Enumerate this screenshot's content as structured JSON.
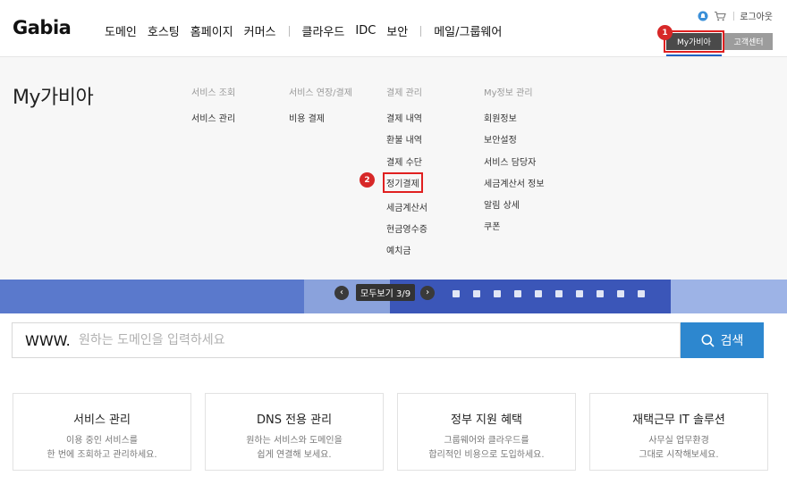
{
  "header": {
    "logo": "Gabia",
    "nav": [
      "도메인",
      "호스팅",
      "홈페이지",
      "커머스",
      "클라우드",
      "IDC",
      "보안",
      "메일/그룹웨어"
    ],
    "logout": "로그아웃",
    "tab_my": "My가비아",
    "tab_cs": "고객센터"
  },
  "annotations": {
    "badge1": "1",
    "badge2": "2"
  },
  "panel": {
    "title": "My가비아",
    "columns": [
      {
        "head": "서비스 조회",
        "links": [
          "서비스 관리"
        ]
      },
      {
        "head": "서비스 연장/결제",
        "links": [
          "비용 결제"
        ]
      },
      {
        "head": "결제 관리",
        "links": [
          "결제 내역",
          "환불 내역",
          "결제 수단",
          "정기결제",
          "세금계산서",
          "현금영수증",
          "예치금"
        ]
      },
      {
        "head": "My정보 관리",
        "links": [
          "회원정보",
          "보안설정",
          "서비스 담당자",
          "세금계산서 정보",
          "알림 상세",
          "쿠폰"
        ]
      }
    ]
  },
  "banner": {
    "pager_label": "모두보기  3/9"
  },
  "search": {
    "prefix": "WWW.",
    "placeholder": "원하는 도메인을 입력하세요",
    "button": "검색"
  },
  "cards": [
    {
      "title": "서비스 관리",
      "line1": "이용 중인 서비스를",
      "line2": "한 번에 조회하고 관리하세요."
    },
    {
      "title": "DNS 전용 관리",
      "line1": "원하는 서비스와 도메인을",
      "line2": "쉽게 연결해 보세요."
    },
    {
      "title": "정부 지원 혜택",
      "line1": "그룹웨어와 클라우드를",
      "line2": "합리적인 비용으로 도입하세요."
    },
    {
      "title": "재택근무 IT 솔루션",
      "line1": "사무실 업무환경",
      "line2": "그대로 시작해보세요."
    }
  ],
  "colors": {
    "accent_blue": "#2d87cf",
    "highlight_red": "#e02020",
    "banner_blue": "#5a79cc"
  }
}
